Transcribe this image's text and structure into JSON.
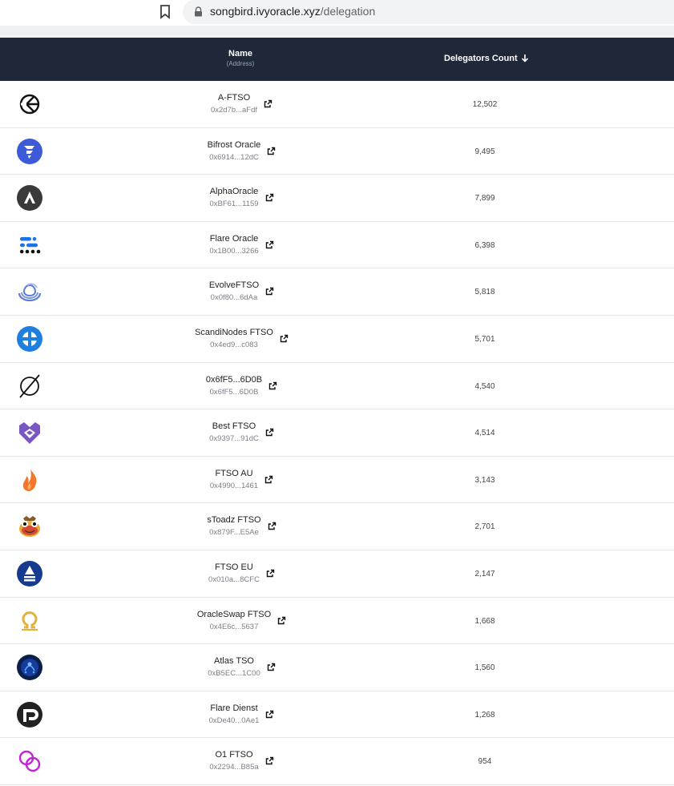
{
  "browser": {
    "url_host": "songbird.ivyoracle.xyz",
    "url_path": "/delegation"
  },
  "table": {
    "header": {
      "name": "Name",
      "address": "(Address)",
      "count": "Delegators Count"
    },
    "rows": [
      {
        "name": "A-FTSO",
        "address": "0x2d7b...aFdf",
        "count": "12,502",
        "logo": "a-ftso-logo"
      },
      {
        "name": "Bifrost Oracle",
        "address": "0x6914...12dC",
        "count": "9,495",
        "logo": "bifrost-logo"
      },
      {
        "name": "AlphaOracle",
        "address": "0xBF61...1159",
        "count": "7,899",
        "logo": "alphaoracle-logo"
      },
      {
        "name": "Flare Oracle",
        "address": "0x1B00...3266",
        "count": "6,398",
        "logo": "flare-oracle-logo"
      },
      {
        "name": "EvolveFTSO",
        "address": "0x0f80...6dAa",
        "count": "5,818",
        "logo": "evolve-logo"
      },
      {
        "name": "ScandiNodes FTSO",
        "address": "0x4ed9...c083",
        "count": "5,701",
        "logo": "scandinodes-logo"
      },
      {
        "name": "0x6fF5...6D0B",
        "address": "0x6fF5...6D0B",
        "count": "4,540",
        "logo": "empty-set-icon"
      },
      {
        "name": "Best FTSO",
        "address": "0x9397...91dC",
        "count": "4,514",
        "logo": "best-ftso-logo"
      },
      {
        "name": "FTSO AU",
        "address": "0x4990...1461",
        "count": "3,143",
        "logo": "flame-logo"
      },
      {
        "name": "sToadz FTSO",
        "address": "0x879F...E5Ae",
        "count": "2,701",
        "logo": "toad-logo"
      },
      {
        "name": "FTSO EU",
        "address": "0x010a...8CFC",
        "count": "2,147",
        "logo": "ftso-eu-logo"
      },
      {
        "name": "OracleSwap FTSO",
        "address": "0x4E6c...5637",
        "count": "1,668",
        "logo": "omega-logo"
      },
      {
        "name": "Atlas TSO",
        "address": "0xB5EC...1C00",
        "count": "1,560",
        "logo": "atlas-logo"
      },
      {
        "name": "Flare Dienst",
        "address": "0xDe40...0Ae1",
        "count": "1,268",
        "logo": "flare-dienst-logo"
      },
      {
        "name": "O1 FTSO",
        "address": "0x2294...B85a",
        "count": "954",
        "logo": "o1-logo"
      }
    ]
  },
  "colors": {
    "header_bg": "#1e2838",
    "row_border": "#e4e6ea",
    "address_text": "#7b7f86"
  }
}
